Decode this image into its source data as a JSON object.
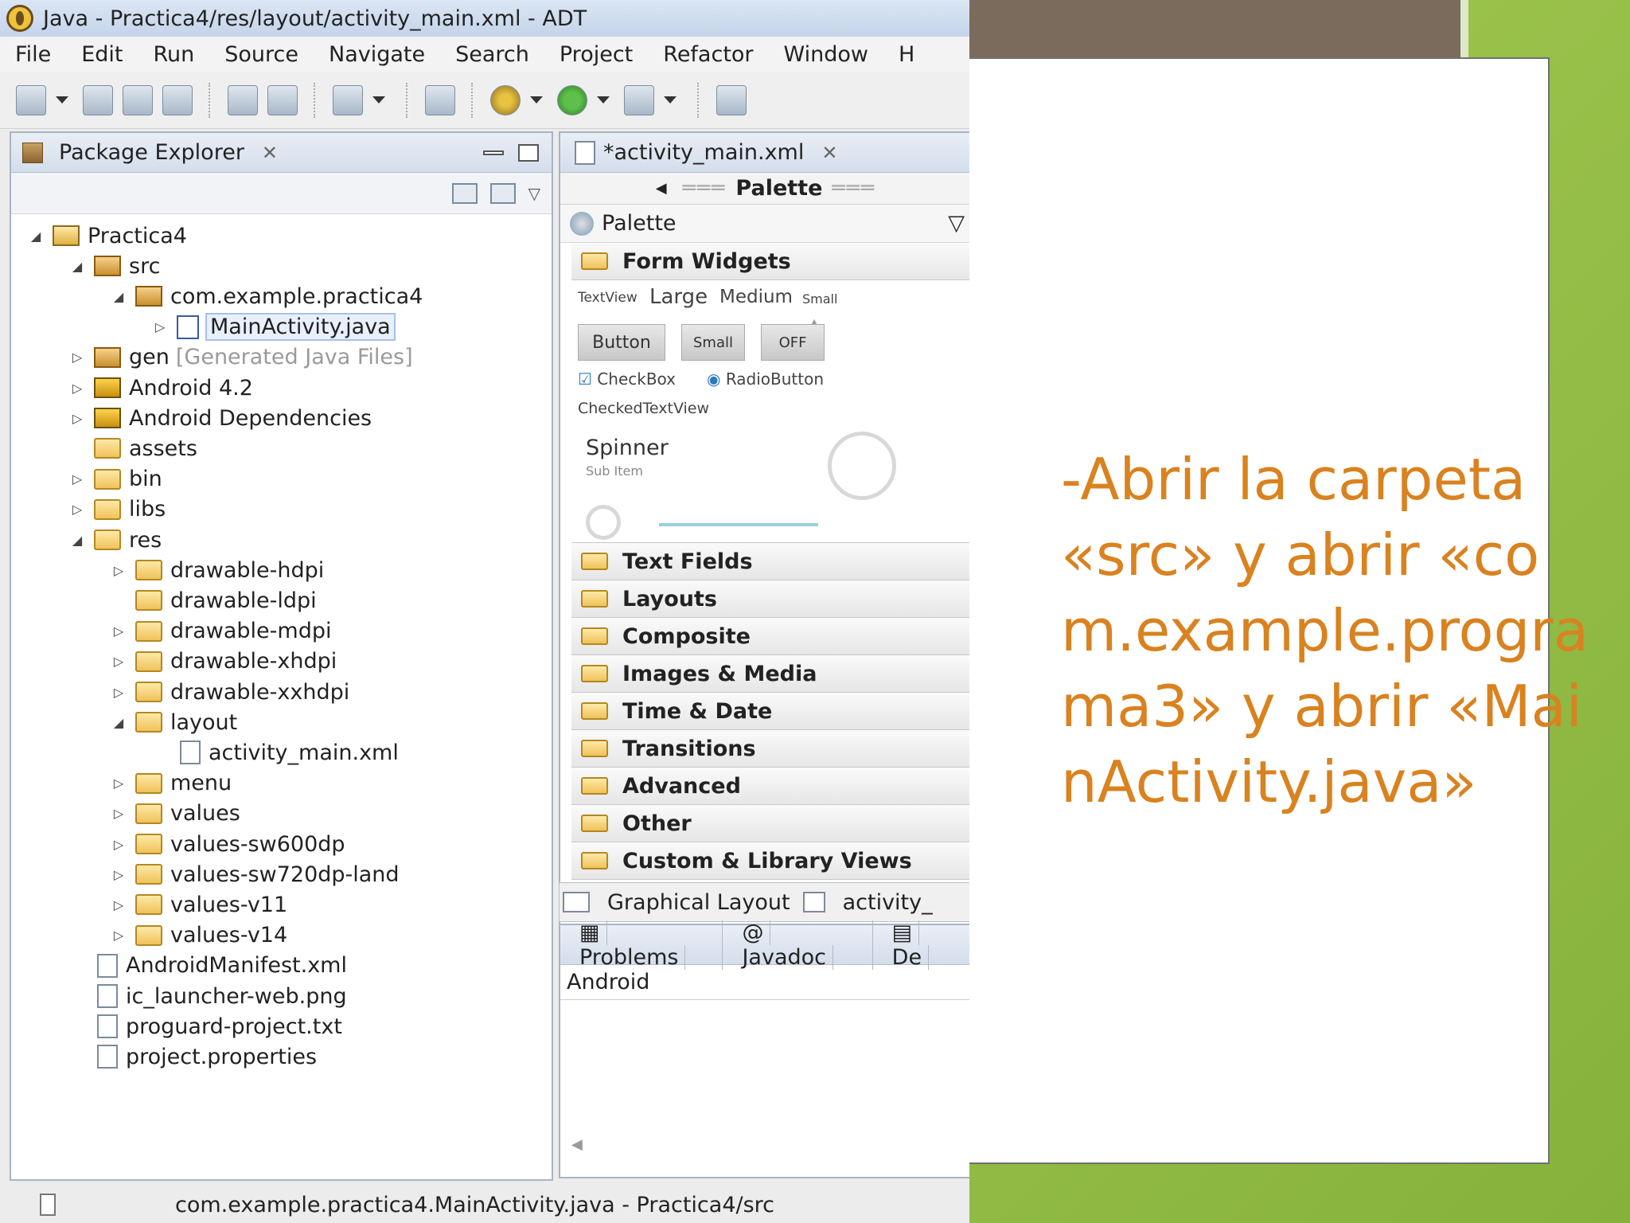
{
  "window": {
    "title": "Java - Practica4/res/layout/activity_main.xml - ADT"
  },
  "menu": [
    "File",
    "Edit",
    "Run",
    "Source",
    "Navigate",
    "Search",
    "Project",
    "Refactor",
    "Window",
    "H"
  ],
  "package_explorer": {
    "title": "Package Explorer",
    "tree": [
      {
        "label": "Practica4",
        "depth": 0,
        "twisty": "expanded",
        "icon": "project-icon"
      },
      {
        "label": "src",
        "depth": 1,
        "twisty": "expanded",
        "icon": "source-folder-icon"
      },
      {
        "label": "com.example.practica4",
        "depth": 2,
        "twisty": "expanded",
        "icon": "package-icon"
      },
      {
        "label": "MainActivity.java",
        "depth": 3,
        "twisty": "collapsed",
        "icon": "java-file-icon",
        "selected": true
      },
      {
        "label": "gen",
        "decor": "[Generated Java Files]",
        "depth": 1,
        "twisty": "collapsed",
        "icon": "source-folder-icon"
      },
      {
        "label": "Android 4.2",
        "depth": 1,
        "twisty": "collapsed",
        "icon": "library-icon"
      },
      {
        "label": "Android Dependencies",
        "depth": 1,
        "twisty": "collapsed",
        "icon": "library-icon"
      },
      {
        "label": "assets",
        "depth": 1,
        "twisty": "none",
        "icon": "folder-icon"
      },
      {
        "label": "bin",
        "depth": 1,
        "twisty": "collapsed",
        "icon": "folder-icon"
      },
      {
        "label": "libs",
        "depth": 1,
        "twisty": "collapsed",
        "icon": "folder-icon"
      },
      {
        "label": "res",
        "depth": 1,
        "twisty": "expanded",
        "icon": "folder-icon"
      },
      {
        "label": "drawable-hdpi",
        "depth": 2,
        "twisty": "collapsed",
        "icon": "folder-icon"
      },
      {
        "label": "drawable-ldpi",
        "depth": 2,
        "twisty": "none",
        "icon": "folder-icon"
      },
      {
        "label": "drawable-mdpi",
        "depth": 2,
        "twisty": "collapsed",
        "icon": "folder-icon"
      },
      {
        "label": "drawable-xhdpi",
        "depth": 2,
        "twisty": "collapsed",
        "icon": "folder-icon"
      },
      {
        "label": "drawable-xxhdpi",
        "depth": 2,
        "twisty": "collapsed",
        "icon": "folder-icon"
      },
      {
        "label": "layout",
        "depth": 2,
        "twisty": "expanded",
        "icon": "folder-icon"
      },
      {
        "label": "activity_main.xml",
        "depth": 3,
        "twisty": "none",
        "icon": "xml-file-icon"
      },
      {
        "label": "menu",
        "depth": 2,
        "twisty": "collapsed",
        "icon": "folder-icon"
      },
      {
        "label": "values",
        "depth": 2,
        "twisty": "collapsed",
        "icon": "folder-icon"
      },
      {
        "label": "values-sw600dp",
        "depth": 2,
        "twisty": "collapsed",
        "icon": "folder-icon"
      },
      {
        "label": "values-sw720dp-land",
        "depth": 2,
        "twisty": "collapsed",
        "icon": "folder-icon"
      },
      {
        "label": "values-v11",
        "depth": 2,
        "twisty": "collapsed",
        "icon": "folder-icon"
      },
      {
        "label": "values-v14",
        "depth": 2,
        "twisty": "collapsed",
        "icon": "folder-icon"
      },
      {
        "label": "AndroidManifest.xml",
        "depth": 1,
        "twisty": "none",
        "icon": "xml-file-icon"
      },
      {
        "label": "ic_launcher-web.png",
        "depth": 1,
        "twisty": "none",
        "icon": "image-file-icon"
      },
      {
        "label": "proguard-project.txt",
        "depth": 1,
        "twisty": "none",
        "icon": "text-file-icon"
      },
      {
        "label": "project.properties",
        "depth": 1,
        "twisty": "none",
        "icon": "text-file-icon"
      }
    ]
  },
  "editor": {
    "tab_label": "*activity_main.xml",
    "palette_title": "Palette",
    "palette_header": "Palette",
    "form_widgets": {
      "label": "Form Widgets",
      "textview": "TextView",
      "large": "Large",
      "medium": "Medium",
      "small": "Small",
      "button": "Button",
      "small_button": "Small",
      "toggle": "OFF",
      "checkbox": "CheckBox",
      "radio": "RadioButton",
      "checked_textview": "CheckedTextView",
      "spinner": "Spinner",
      "spinner_sub": "Sub Item"
    },
    "categories": [
      "Text Fields",
      "Layouts",
      "Composite",
      "Images & Media",
      "Time & Date",
      "Transitions",
      "Advanced",
      "Other",
      "Custom & Library Views"
    ],
    "bottom_tabs": [
      "Graphical Layout",
      "activity_"
    ]
  },
  "problems_view": {
    "tabs": [
      "Problems",
      "Javadoc",
      "De"
    ],
    "row": "Android"
  },
  "status_bar": {
    "text": "com.example.practica4.MainActivity.java - Practica4/src"
  },
  "slide": {
    "text": "-Abrir la carpeta «src» y abrir «com.example.programa3» y abrir «MainActivity.java»",
    "text_color": "#d9821f"
  }
}
